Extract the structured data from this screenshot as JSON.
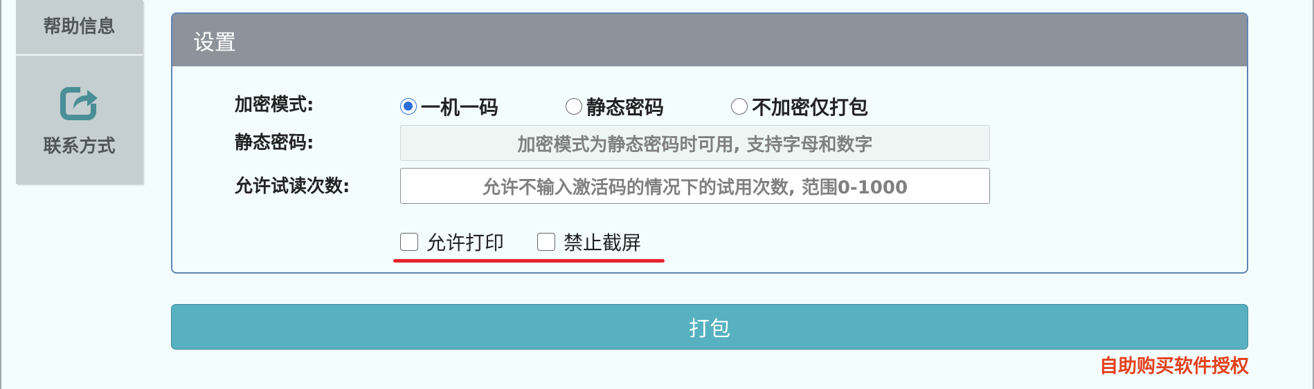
{
  "sidebar": {
    "items": [
      {
        "label": "帮助信息",
        "icon": "help-icon"
      },
      {
        "label": "联系方式",
        "icon": "share-icon"
      }
    ]
  },
  "settings": {
    "title": "设置",
    "encrypt_mode": {
      "label": "加密模式:",
      "options": [
        "一机一码",
        "静态密码",
        "不加密仅打包"
      ],
      "selected": "一机一码"
    },
    "static_password": {
      "label": "静态密码:",
      "placeholder": "加密模式为静态密码时可用, 支持字母和数字",
      "value": ""
    },
    "trial_count": {
      "label": "允许试读次数:",
      "placeholder": "允许不输入激活码的情况下的试用次数, 范围0-1000",
      "value": ""
    },
    "checkboxes": [
      {
        "label": "允许打印",
        "checked": false
      },
      {
        "label": "禁止截屏",
        "checked": false
      }
    ]
  },
  "pack_button": {
    "label": "打包"
  },
  "buy_link": {
    "label": "自助购买软件授权"
  },
  "colors": {
    "header_bg": "#8c939b",
    "accent_blue": "#2c6fd9",
    "button_teal": "#57b1c0",
    "link_red": "#e4411f",
    "underline_red": "#e4242a"
  }
}
